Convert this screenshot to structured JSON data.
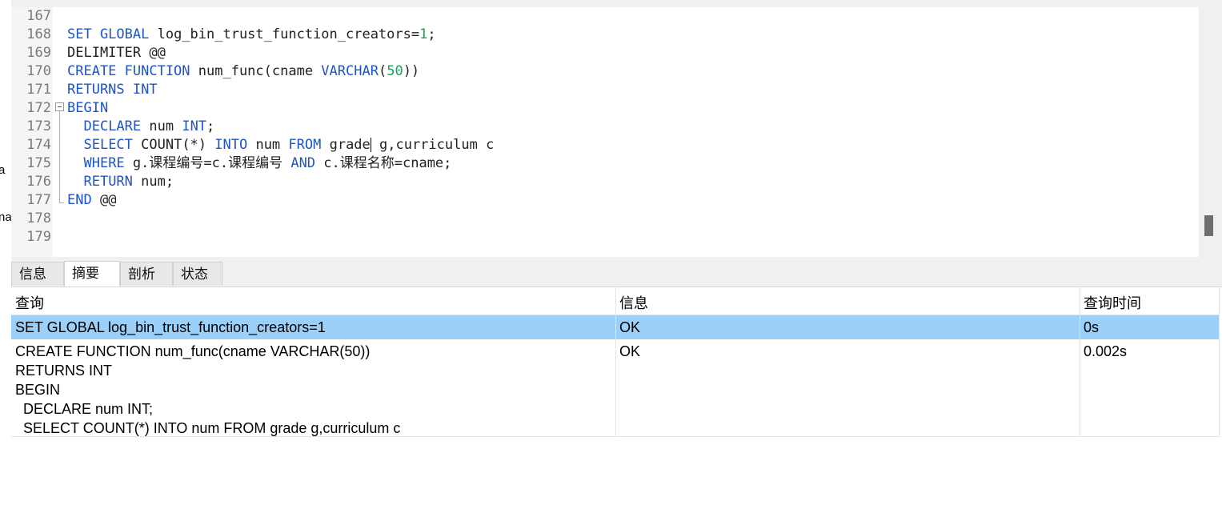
{
  "left_strip": {
    "char_a": "a",
    "char_b": "na"
  },
  "editor": {
    "lines": [
      {
        "num": "167",
        "tokens": []
      },
      {
        "num": "168",
        "tokens": [
          [
            "kw",
            "SET GLOBAL"
          ],
          [
            "t",
            " log_bin_trust_function_creators="
          ],
          [
            "num",
            "1"
          ],
          [
            "t",
            ";"
          ]
        ]
      },
      {
        "num": "169",
        "tokens": [
          [
            "t",
            "DELIMITER @@"
          ]
        ]
      },
      {
        "num": "170",
        "tokens": [
          [
            "kw",
            "CREATE FUNCTION"
          ],
          [
            "t",
            " num_func(cname "
          ],
          [
            "kw",
            "VARCHAR"
          ],
          [
            "t",
            "("
          ],
          [
            "num",
            "50"
          ],
          [
            "t",
            "))"
          ]
        ]
      },
      {
        "num": "171",
        "tokens": [
          [
            "kw",
            "RETURNS INT"
          ]
        ]
      },
      {
        "num": "172",
        "tokens": [
          [
            "kw",
            "BEGIN"
          ]
        ]
      },
      {
        "num": "173",
        "tokens": [
          [
            "t",
            "  "
          ],
          [
            "kw",
            "DECLARE"
          ],
          [
            "t",
            " num "
          ],
          [
            "kw",
            "INT"
          ],
          [
            "t",
            ";"
          ]
        ]
      },
      {
        "num": "174",
        "tokens": [
          [
            "t",
            "  "
          ],
          [
            "kw",
            "SELECT"
          ],
          [
            "t",
            " COUNT(*) "
          ],
          [
            "kw",
            "INTO"
          ],
          [
            "t",
            " num "
          ],
          [
            "kw",
            "FROM"
          ],
          [
            "t",
            " grade"
          ],
          [
            "caret",
            ""
          ],
          [
            "t",
            " g,curriculum c"
          ]
        ]
      },
      {
        "num": "175",
        "tokens": [
          [
            "t",
            "  "
          ],
          [
            "kw",
            "WHERE"
          ],
          [
            "t",
            " g.课程编号=c.课程编号 "
          ],
          [
            "kw",
            "AND"
          ],
          [
            "t",
            " c.课程名称=cname;"
          ]
        ]
      },
      {
        "num": "176",
        "tokens": [
          [
            "t",
            "  "
          ],
          [
            "kw",
            "RETURN"
          ],
          [
            "t",
            " num;"
          ]
        ]
      },
      {
        "num": "177",
        "tokens": [
          [
            "kw",
            "END"
          ],
          [
            "t",
            " @@"
          ]
        ]
      },
      {
        "num": "178",
        "tokens": []
      },
      {
        "num": "179",
        "tokens": []
      }
    ]
  },
  "tabs": [
    {
      "label": "信息",
      "active": false
    },
    {
      "label": "摘要",
      "active": true
    },
    {
      "label": "剖析",
      "active": false
    },
    {
      "label": "状态",
      "active": false
    }
  ],
  "results": {
    "headers": {
      "query": "查询",
      "info": "信息",
      "time": "查询时间"
    },
    "rows": [
      {
        "query": "SET GLOBAL log_bin_trust_function_creators=1",
        "info": "OK",
        "time": "0s",
        "selected": true
      },
      {
        "query": "CREATE FUNCTION num_func(cname VARCHAR(50))\nRETURNS INT\nBEGIN\n  DECLARE num INT;\n  SELECT COUNT(*) INTO num FROM grade g,curriculum c",
        "info": "OK",
        "time": "0.002s",
        "selected": false
      }
    ]
  },
  "colors": {
    "keyword": "#1f54c4",
    "number": "#19a34f",
    "selection": "#9dd0f8"
  }
}
